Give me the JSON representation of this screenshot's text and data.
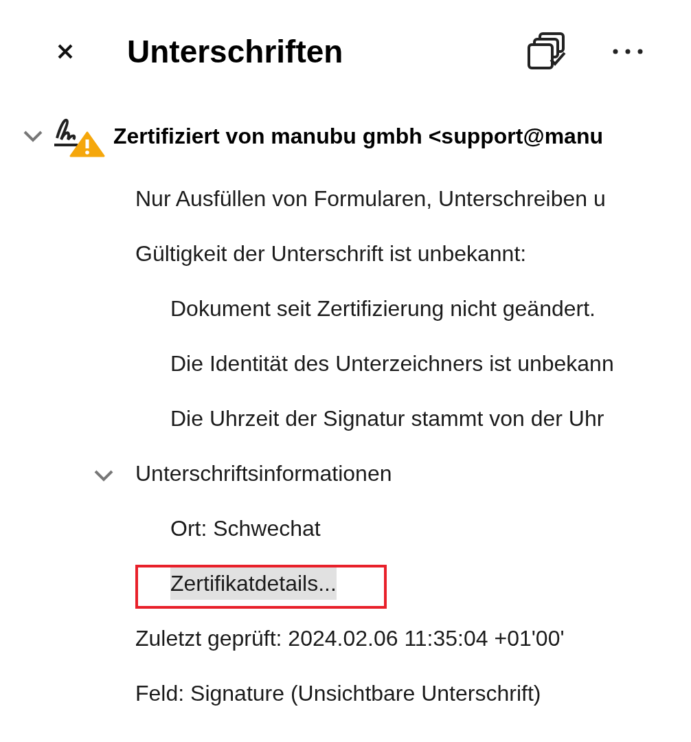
{
  "panel": {
    "title": "Unterschriften"
  },
  "signature": {
    "title": "Zertifiziert von manubu gmbh <support@manu",
    "expanded": true,
    "items": [
      {
        "text": "Nur Ausfüllen von Formularen, Unterschreiben u"
      },
      {
        "text": "Gültigkeit der Unterschrift ist unbekannt:",
        "children": [
          {
            "text": "Dokument seit Zertifizierung nicht geändert."
          },
          {
            "text": "Die Identität des Unterzeichners ist unbekann"
          },
          {
            "text": "Die Uhrzeit der Signatur stammt von der Uhr"
          }
        ]
      },
      {
        "text": "Unterschriftsinformationen",
        "expanded": true,
        "children": [
          {
            "text": "Ort: Schwechat",
            "selected": false,
            "highlighted": false
          },
          {
            "text": "Zertifikatdetails...",
            "selected": true,
            "highlighted": true
          }
        ]
      },
      {
        "text": "Zuletzt geprüft: 2024.02.06 11:35:04 +01'00'"
      },
      {
        "text": "Feld: Signature (Unsichtbare Unterschrift)"
      }
    ]
  }
}
